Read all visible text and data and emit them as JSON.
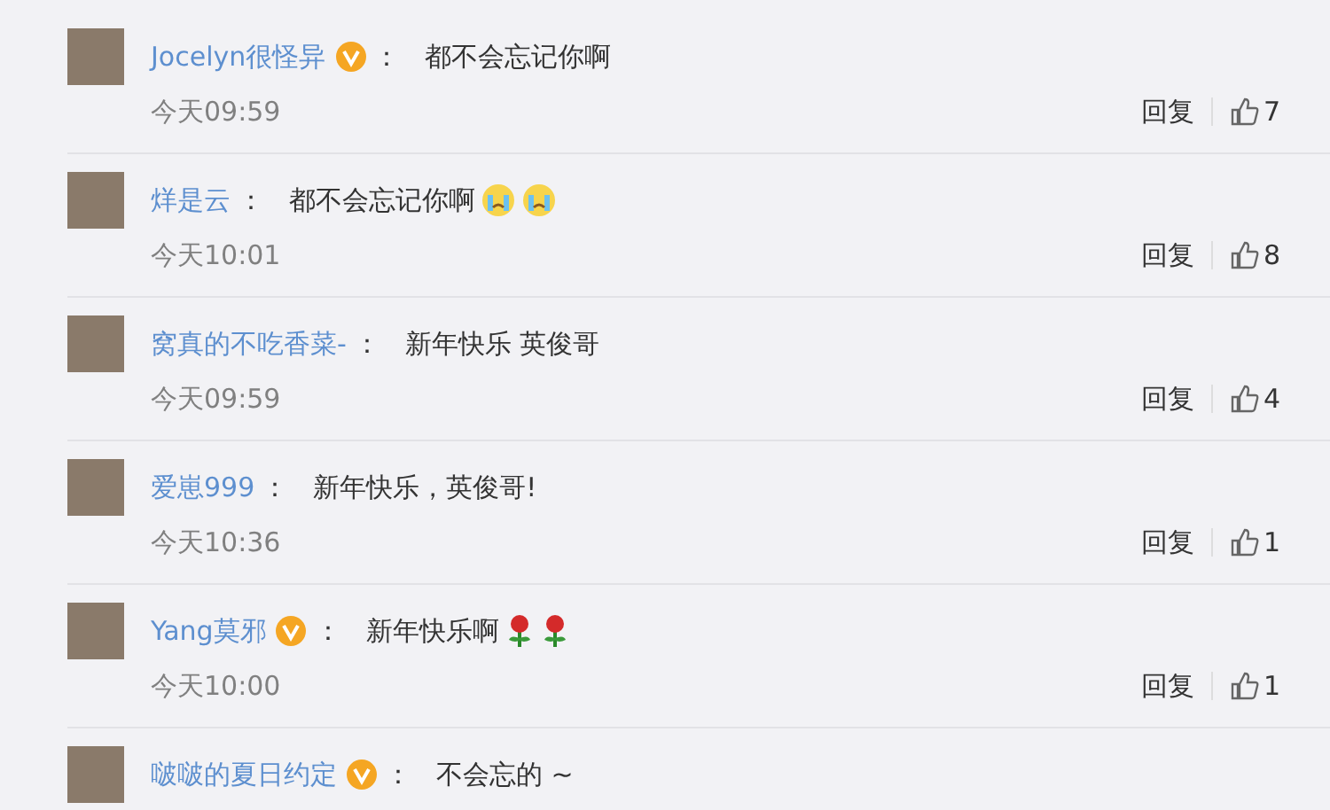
{
  "comments": [
    {
      "user": "Jocelyn很怪异",
      "verified": true,
      "colon": "：",
      "text": "都不会忘记你啊",
      "time": "今天09:59",
      "reply": "回复",
      "likes": "7"
    },
    {
      "user": "烊是云",
      "verified": false,
      "colon": "：",
      "text": "都不会忘记你啊",
      "emojis": [
        {
          "kind": "crying"
        },
        {
          "kind": "crying"
        }
      ],
      "time": "今天10:01",
      "reply": "回复",
      "likes": "8"
    },
    {
      "user": "窝真的不吃香菜-",
      "verified": false,
      "colon": "：",
      "text": "新年快乐 英俊哥",
      "time": "今天09:59",
      "reply": "回复",
      "likes": "4"
    },
    {
      "user": "爱崽999",
      "verified": false,
      "colon": "：",
      "text": "新年快乐，英俊哥!",
      "time": "今天10:36",
      "reply": "回复",
      "likes": "1"
    },
    {
      "user": "Yang莫邪",
      "verified": true,
      "colon": "：",
      "text": "新年快乐啊",
      "emojis": [
        {
          "kind": "rose"
        },
        {
          "kind": "rose"
        }
      ],
      "time": "今天10:00",
      "reply": "回复",
      "likes": "1"
    },
    {
      "user": "啵啵的夏日约定",
      "verified": true,
      "colon": "：",
      "text": "不会忘的 ~"
    }
  ]
}
